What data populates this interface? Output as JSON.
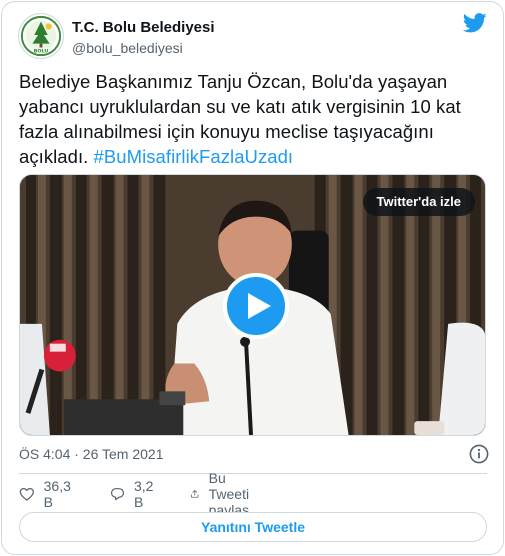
{
  "author": {
    "display_name": "T.C. Bolu Belediyesi",
    "handle": "@bolu_belediyesi",
    "avatar_logo_text": "BOLU"
  },
  "tweet": {
    "text": "Belediye Başkanımız Tanju Özcan, Bolu'da yaşayan yabancı uyruklulardan su ve katı atık vergisinin 10 kat fazla alınabilmesi için konuyu meclise taşıyacağını açıkladı. ",
    "hashtag": "#BuMisafirlikFazlaUzadı"
  },
  "media": {
    "watch_label": "Twitter'da izle"
  },
  "meta": {
    "timestamp": "ÖS 4:04 · 26 Tem 2021"
  },
  "actions": {
    "likes": "36,3 B",
    "replies": "3,2 B",
    "share_label": "Bu Tweeti paylaş"
  },
  "reply_button_label": "Yanıtını Tweetle",
  "colors": {
    "accent": "#1d9bf0",
    "text_primary": "#0f1419",
    "text_secondary": "#536471",
    "border": "#cfd9de"
  },
  "icons": [
    "twitter-bird-icon",
    "play-icon",
    "info-icon",
    "heart-icon",
    "reply-bubble-icon",
    "share-icon"
  ]
}
